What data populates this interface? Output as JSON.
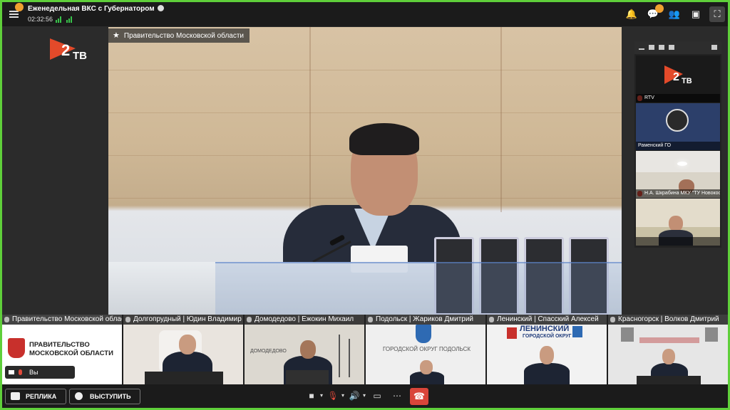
{
  "header": {
    "title": "Еженедельная ВКС с Губернатором",
    "timer": "02:32:56"
  },
  "main": {
    "speaker_label": "Правительство Московской области",
    "logo_text": "ТВ"
  },
  "side_tiles": [
    {
      "label": "RTV"
    },
    {
      "label": "Раменский ГО"
    },
    {
      "label": "Н.А. Шкрабина МКУ \"ТУ Новокосино\""
    },
    {
      "label": ""
    }
  ],
  "side_logo_text": "ТВ",
  "thumbnails": [
    {
      "label": "Правительство Московской области",
      "gov_line1": "ПРАВИТЕЛЬСТВО",
      "gov_line2": "МОСКОВСКОЙ ОБЛАСТИ",
      "you": "Вы"
    },
    {
      "label": "Долгопрудный | Юдин Владимир"
    },
    {
      "label": "Домодедово | Ежокин Михаил",
      "sign": "ДОМОДЕДОВО"
    },
    {
      "label": "Подольск | Жариков Дмитрий",
      "sign": "ГОРОДСКОЙ ОКРУГ ПОДОЛЬСК"
    },
    {
      "label": "Ленинский | Спасский Алексей",
      "sign1": "ЛЕНИНСКИЙ",
      "sign2": "ГОРОДСКОЙ ОКРУГ"
    },
    {
      "label": "Красногорск | Волков Дмитрий"
    }
  ],
  "bottom": {
    "reply_button": "РЕПЛИКА",
    "speak_button": "ВЫСТУПИТЬ"
  },
  "colors": {
    "accent_green": "#5fcf3a",
    "hangup_red": "#d9453a",
    "mic_muted": "#e14a3b"
  }
}
